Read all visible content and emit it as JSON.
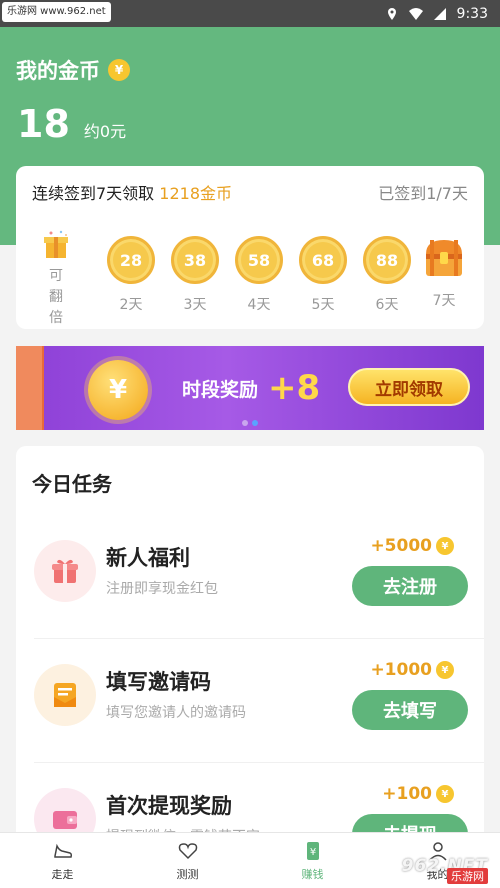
{
  "status_bar": {
    "watermark": "乐游网 www.962.net",
    "time": "9:33"
  },
  "header": {
    "title": "我的金币",
    "coins": "18",
    "approx": "约0元"
  },
  "signin": {
    "title_prefix": "连续签到7天领取",
    "title_reward": "1218金币",
    "progress": "已签到1/7天",
    "gift_label": "可翻倍",
    "days": [
      {
        "coins": "28",
        "label": "2天"
      },
      {
        "coins": "38",
        "label": "3天"
      },
      {
        "coins": "58",
        "label": "4天"
      },
      {
        "coins": "68",
        "label": "5天"
      },
      {
        "coins": "88",
        "label": "6天"
      },
      {
        "coins": "",
        "label": "7天"
      }
    ]
  },
  "banner": {
    "coin_symbol": "¥",
    "text": "时段奖励",
    "bonus": "+8",
    "button": "立即领取"
  },
  "tasks": {
    "title": "今日任务",
    "items": [
      {
        "name": "新人福利",
        "desc": "注册即享现金红包",
        "reward": "+5000",
        "button": "去注册",
        "icon": "gift-icon"
      },
      {
        "name": "填写邀请码",
        "desc": "填写您邀请人的邀请码",
        "reward": "+1000",
        "button": "去填写",
        "icon": "envelope-icon"
      },
      {
        "name": "首次提现奖励",
        "desc": "提现到微信，零钱花不完",
        "reward": "+100",
        "button": "去提现",
        "icon": "wallet-icon"
      }
    ]
  },
  "nav": {
    "items": [
      {
        "label": "走走",
        "icon": "shoe-icon"
      },
      {
        "label": "测测",
        "icon": "heart-icon"
      },
      {
        "label": "赚钱",
        "icon": "money-icon"
      },
      {
        "label": "我的",
        "icon": "person-icon"
      }
    ]
  },
  "watermark": {
    "brand": "962.NET",
    "sub": "乐游网"
  },
  "colors": {
    "brand_green": "#64b87f",
    "coin_gold": "#f6c94c",
    "reward_orange": "#e8a020",
    "banner_purple": "#8c3fd6"
  }
}
